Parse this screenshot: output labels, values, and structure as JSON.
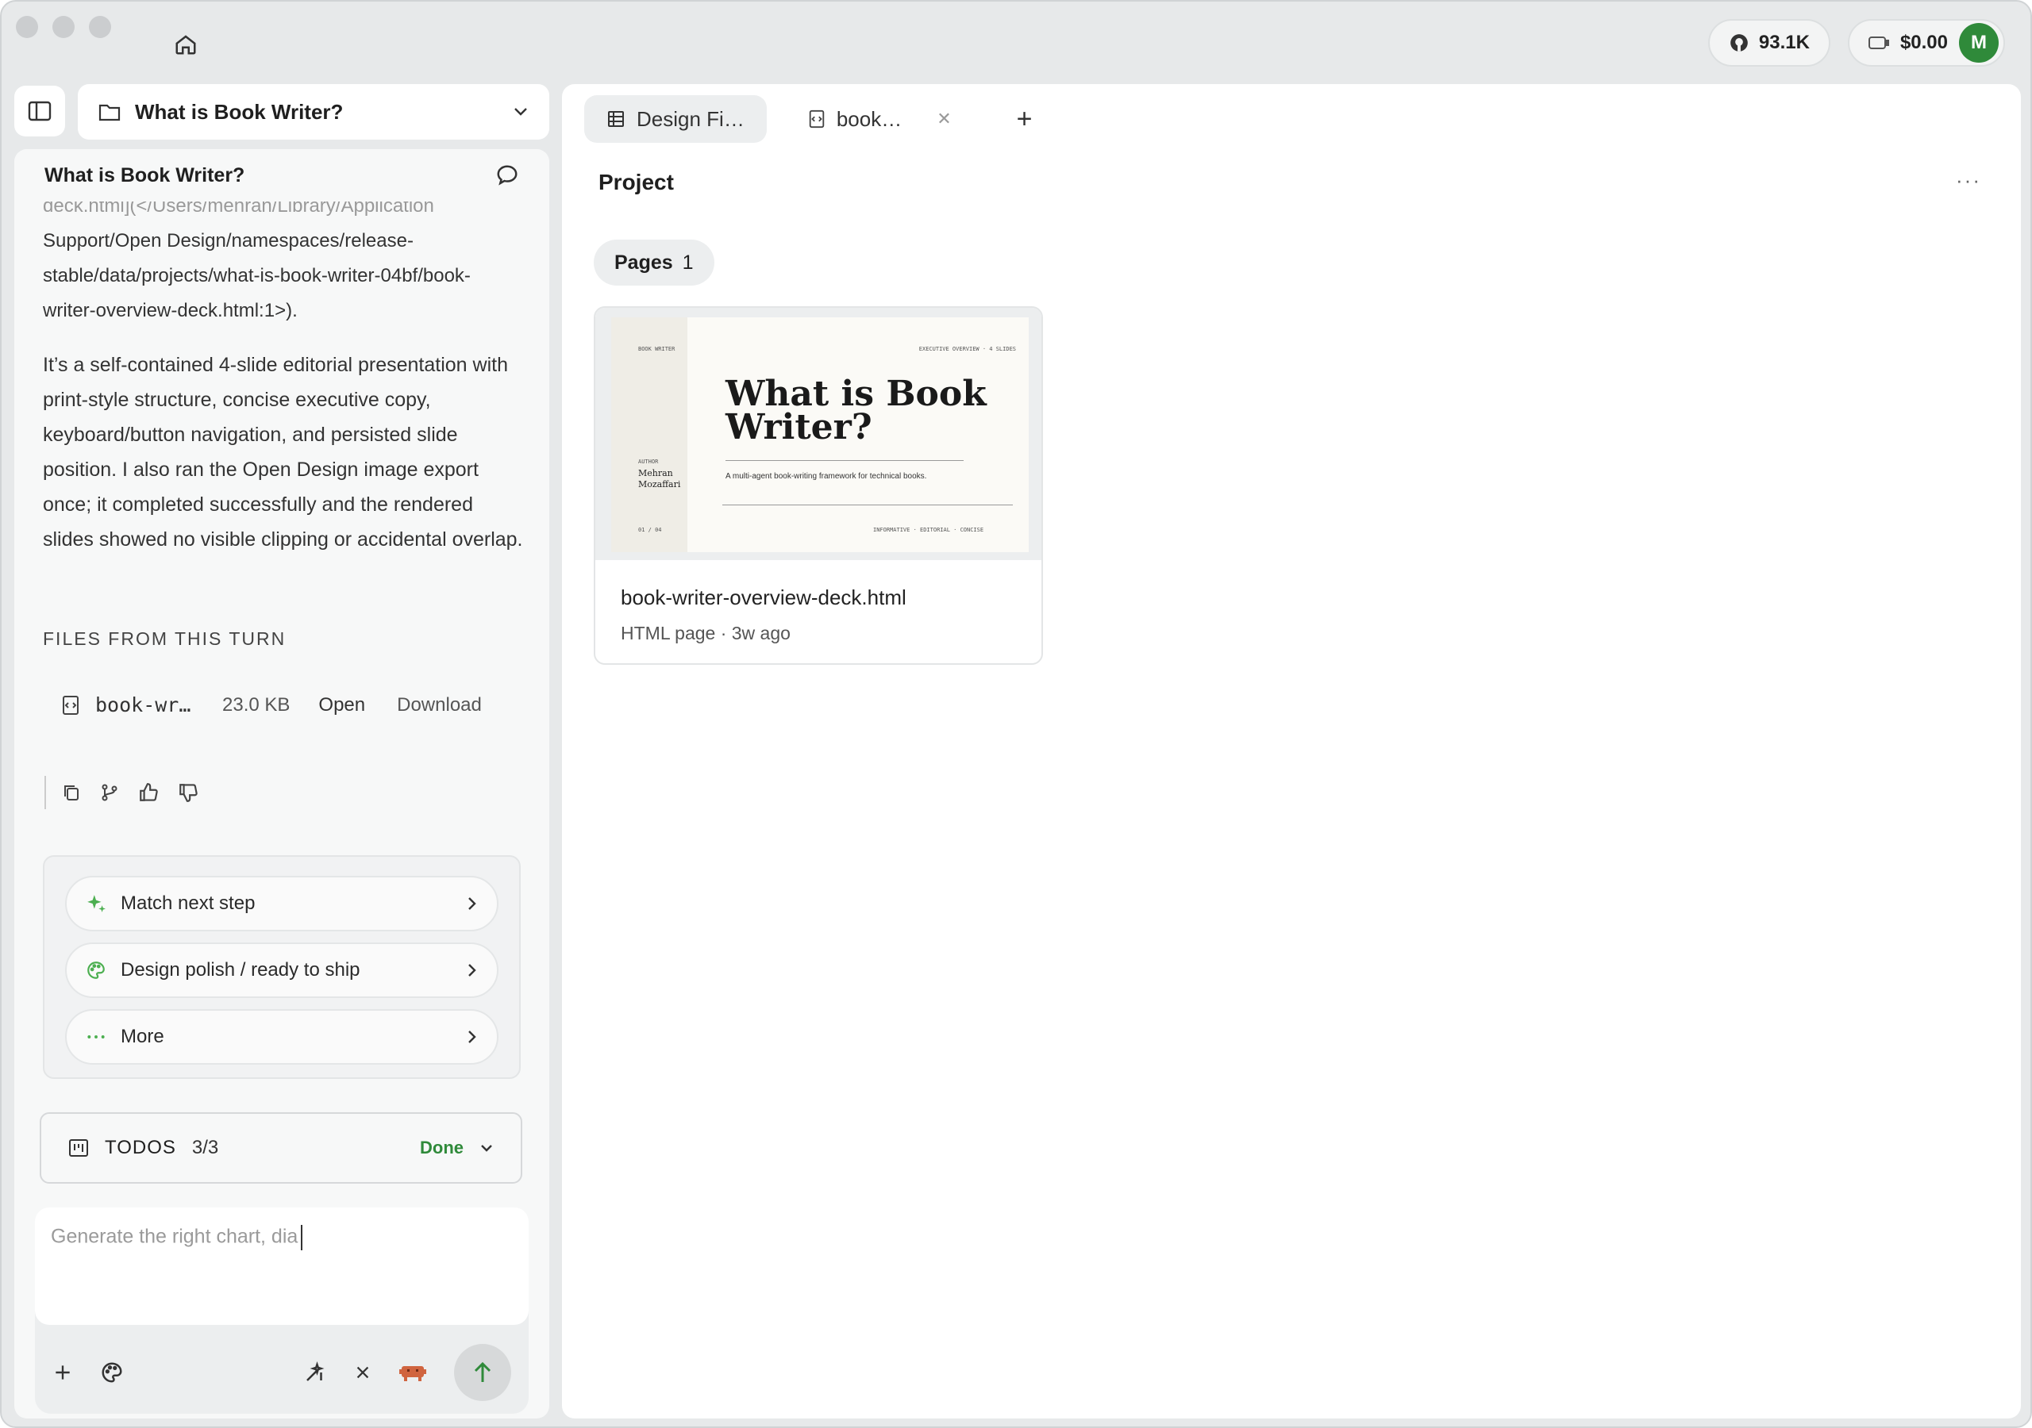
{
  "topbar": {
    "github_stars": "93.1K",
    "cost": "$0.00",
    "avatar_initial": "M"
  },
  "project": {
    "name": "What is Book Writer?"
  },
  "chat": {
    "title": "What is Book Writer?",
    "message_cut_line": "deck.html](</Users/mehran/Library/Application",
    "message_path": "Support/Open Design/namespaces/release-stable/data/projects/what-is-book-writer-04bf/book-writer-overview-deck.html:1>).",
    "message_body": "It’s a self-contained 4-slide editorial presentation with print-style structure, concise executive copy, keyboard/button navigation, and persisted slide position. I also ran the Open Design image export once; it completed successfully and the rendered slides showed no visible clipping or accidental overlap.",
    "files_label": "FILES FROM THIS TURN",
    "file": {
      "name": "book-wr…",
      "size": "23.0 KB",
      "open_label": "Open",
      "download_label": "Download"
    },
    "suggestions": [
      {
        "label": "Match next step",
        "icon": "sparkle-icon"
      },
      {
        "label": "Design polish / ready to ship",
        "icon": "palette-icon"
      },
      {
        "label": "More",
        "icon": "dots-icon"
      }
    ],
    "todos": {
      "label": "TODOS",
      "count": "3/3",
      "status": "Done"
    },
    "composer": {
      "placeholder": "Generate the right chart, dia"
    }
  },
  "main": {
    "tabs": [
      {
        "label": "Design Fi…",
        "active": true
      },
      {
        "label": "book…",
        "active": false
      }
    ],
    "title": "Project",
    "pages_label": "Pages",
    "pages_count": "1",
    "card": {
      "file_name": "book-writer-overview-deck.html",
      "meta": "HTML page · 3w ago",
      "thumb": {
        "brand": "BOOK WRITER",
        "kicker": "EXECUTIVE OVERVIEW · 4 SLIDES",
        "headline": "What is Book Writer?",
        "subtitle": "A multi-agent book-writing framework for technical books.",
        "author_label": "AUTHOR",
        "author": "Mehran Mozaffari",
        "page": "01 / 04",
        "tags": "INFORMATIVE · EDITORIAL · CONCISE"
      }
    }
  },
  "colors": {
    "accent_green": "#2f8a3a",
    "window_bg": "#e7e9ea"
  }
}
